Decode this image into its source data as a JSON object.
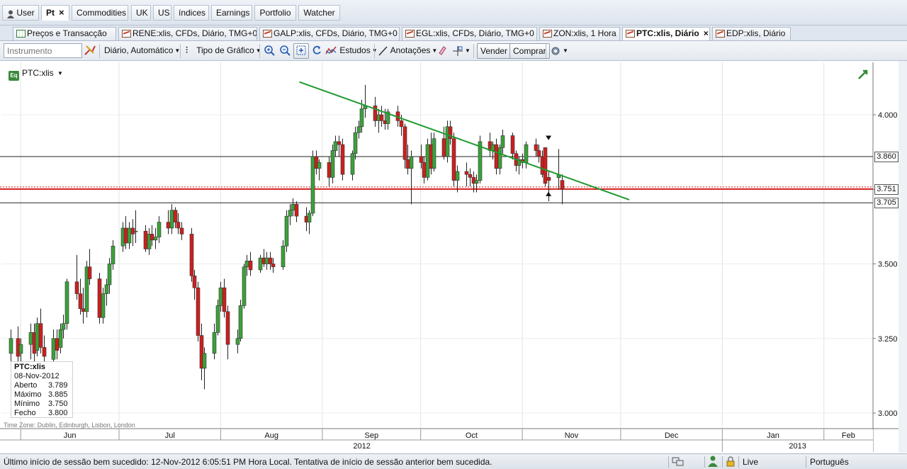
{
  "main_tabs": [
    {
      "label": "User",
      "icon": "user-icon"
    },
    {
      "label": "Pt",
      "active": true,
      "closable": true
    },
    {
      "label": "Commodities"
    },
    {
      "label": "UK"
    },
    {
      "label": "US"
    },
    {
      "label": "índices"
    },
    {
      "label": "Earnings"
    },
    {
      "label": "Portfolio"
    },
    {
      "label": "Watcher"
    }
  ],
  "chart_tabs": [
    {
      "label": "Preços e Transacção",
      "icon": "grid-icon"
    },
    {
      "label": "RENE:xlis, CFDs, Diário, TMG+0",
      "icon": "chart-icon"
    },
    {
      "label": "GALP:xlis, CFDs, Diário, TMG+0",
      "icon": "chart-icon"
    },
    {
      "label": "EGL:xlis, CFDs, Diário, TMG+0",
      "icon": "chart-icon"
    },
    {
      "label": "ZON:xlis, 1 Hora",
      "icon": "chart-icon"
    },
    {
      "label": "PTC:xlis, Diário",
      "icon": "chart-icon",
      "active": true,
      "closable": true
    },
    {
      "label": "EDP:xlis, Diário",
      "icon": "chart-icon"
    }
  ],
  "toolbar": {
    "instrument_placeholder": "Instrumento",
    "period": "Diário,  Automático",
    "chart_type": "Tipo de Gráfico",
    "studies": "Estudos",
    "annotations": "Anotações",
    "sell": "Vender",
    "buy": "Comprar"
  },
  "chart": {
    "symbol": "PTC:xlis",
    "time_zone": "Time Zone: Dublin, Edinburgh, Lisbon, London",
    "infobox": {
      "symbol": "PTC:xlis",
      "date": "08-Nov-2012",
      "rows": [
        {
          "label": "Aberto",
          "value": "3.789"
        },
        {
          "label": "Máximo",
          "value": "3.885"
        },
        {
          "label": "Mínimo",
          "value": "3.750"
        },
        {
          "label": "Fecho",
          "value": "3.800"
        }
      ]
    },
    "price_labels": {
      "resistance": "3.860",
      "current": "3.751",
      "support": "3.705"
    },
    "colors": {
      "up": "#3aa13a",
      "down": "#cc1f1f",
      "trendline": "#1f9a2f",
      "current_line": "#d81e1e"
    }
  },
  "chart_data": {
    "type": "candlestick",
    "ylim": [
      2.97,
      4.17
    ],
    "y_ticks": [
      "4.000",
      "3.750",
      "3.500",
      "3.250",
      "3.000"
    ],
    "months": [
      "Jun",
      "Jul",
      "Aug",
      "Sep",
      "Oct",
      "Nov",
      "Dec",
      "Jan",
      "Feb"
    ],
    "years": [
      "2012",
      "2013"
    ],
    "horizontal_lines": [
      3.86,
      3.751,
      3.705
    ],
    "trendline": {
      "from": {
        "date": "2012-08-25",
        "price": 4.11
      },
      "to": {
        "date": "2012-11-12",
        "price": 3.8
      }
    },
    "candles": [
      {
        "date": "2012-05-22",
        "o": 3.1,
        "h": 3.3,
        "l": 3.08,
        "c": 3.2
      },
      {
        "date": "2012-05-24",
        "o": 3.18,
        "h": 3.26,
        "l": 3.14,
        "c": 3.22
      },
      {
        "date": "2012-05-29",
        "o": 3.2,
        "h": 3.28,
        "l": 3.16,
        "c": 3.25
      },
      {
        "date": "2012-05-31",
        "o": 3.25,
        "h": 3.29,
        "l": 3.17,
        "c": 3.19
      },
      {
        "date": "2012-06-01",
        "o": 3.2,
        "h": 3.25,
        "l": 3.14,
        "c": 3.23
      },
      {
        "date": "2012-06-04",
        "o": 3.23,
        "h": 3.3,
        "l": 3.18,
        "c": 3.27
      },
      {
        "date": "2012-06-05",
        "o": 3.27,
        "h": 3.3,
        "l": 3.17,
        "c": 3.2
      },
      {
        "date": "2012-06-06",
        "o": 3.21,
        "h": 3.32,
        "l": 3.19,
        "c": 3.3
      },
      {
        "date": "2012-06-07",
        "o": 3.3,
        "h": 3.35,
        "l": 3.2,
        "c": 3.22
      },
      {
        "date": "2012-06-08",
        "o": 3.22,
        "h": 3.26,
        "l": 3.14,
        "c": 3.19
      },
      {
        "date": "2012-06-11",
        "o": 3.18,
        "h": 3.28,
        "l": 3.15,
        "c": 3.25
      },
      {
        "date": "2012-06-12",
        "o": 3.25,
        "h": 3.28,
        "l": 3.18,
        "c": 3.21
      },
      {
        "date": "2012-06-13",
        "o": 3.22,
        "h": 3.3,
        "l": 3.2,
        "c": 3.28
      },
      {
        "date": "2012-06-14",
        "o": 3.28,
        "h": 3.33,
        "l": 3.25,
        "c": 3.3
      },
      {
        "date": "2012-06-15",
        "o": 3.3,
        "h": 3.45,
        "l": 3.28,
        "c": 3.44
      },
      {
        "date": "2012-06-18",
        "o": 3.44,
        "h": 3.53,
        "l": 3.38,
        "c": 3.4
      },
      {
        "date": "2012-06-19",
        "o": 3.4,
        "h": 3.45,
        "l": 3.33,
        "c": 3.35
      },
      {
        "date": "2012-06-20",
        "o": 3.35,
        "h": 3.42,
        "l": 3.3,
        "c": 3.34
      },
      {
        "date": "2012-06-21",
        "o": 3.34,
        "h": 3.51,
        "l": 3.32,
        "c": 3.49
      },
      {
        "date": "2012-06-22",
        "o": 3.49,
        "h": 3.55,
        "l": 3.43,
        "c": 3.45
      },
      {
        "date": "2012-06-25",
        "o": 3.45,
        "h": 3.47,
        "l": 3.3,
        "c": 3.32
      },
      {
        "date": "2012-06-26",
        "o": 3.32,
        "h": 3.42,
        "l": 3.3,
        "c": 3.4
      },
      {
        "date": "2012-06-27",
        "o": 3.4,
        "h": 3.45,
        "l": 3.36,
        "c": 3.43
      },
      {
        "date": "2012-06-28",
        "o": 3.43,
        "h": 3.52,
        "l": 3.4,
        "c": 3.5
      },
      {
        "date": "2012-06-29",
        "o": 3.5,
        "h": 3.58,
        "l": 3.48,
        "c": 3.56
      },
      {
        "date": "2012-07-02",
        "o": 3.56,
        "h": 3.64,
        "l": 3.54,
        "c": 3.62
      },
      {
        "date": "2012-07-03",
        "o": 3.62,
        "h": 3.66,
        "l": 3.55,
        "c": 3.57
      },
      {
        "date": "2012-07-04",
        "o": 3.57,
        "h": 3.64,
        "l": 3.55,
        "c": 3.62
      },
      {
        "date": "2012-07-05",
        "o": 3.62,
        "h": 3.65,
        "l": 3.56,
        "c": 3.6
      },
      {
        "date": "2012-07-06",
        "o": 3.61,
        "h": 3.68,
        "l": 3.57,
        "c": 3.61
      },
      {
        "date": "2012-07-09",
        "o": 3.61,
        "h": 3.63,
        "l": 3.54,
        "c": 3.55
      },
      {
        "date": "2012-07-10",
        "o": 3.55,
        "h": 3.62,
        "l": 3.53,
        "c": 3.6
      },
      {
        "date": "2012-07-11",
        "o": 3.6,
        "h": 3.63,
        "l": 3.56,
        "c": 3.58
      },
      {
        "date": "2012-07-12",
        "o": 3.58,
        "h": 3.62,
        "l": 3.55,
        "c": 3.59
      },
      {
        "date": "2012-07-13",
        "o": 3.59,
        "h": 3.66,
        "l": 3.57,
        "c": 3.64
      },
      {
        "date": "2012-07-16",
        "o": 3.64,
        "h": 3.68,
        "l": 3.6,
        "c": 3.62
      },
      {
        "date": "2012-07-17",
        "o": 3.62,
        "h": 3.7,
        "l": 3.6,
        "c": 3.68
      },
      {
        "date": "2012-07-18",
        "o": 3.68,
        "h": 3.69,
        "l": 3.62,
        "c": 3.64
      },
      {
        "date": "2012-07-19",
        "o": 3.64,
        "h": 3.67,
        "l": 3.6,
        "c": 3.62
      },
      {
        "date": "2012-07-20",
        "o": 3.62,
        "h": 3.64,
        "l": 3.58,
        "c": 3.6
      },
      {
        "date": "2012-07-23",
        "o": 3.6,
        "h": 3.62,
        "l": 3.44,
        "c": 3.46
      },
      {
        "date": "2012-07-24",
        "o": 3.46,
        "h": 3.48,
        "l": 3.38,
        "c": 3.42
      },
      {
        "date": "2012-07-25",
        "o": 3.42,
        "h": 3.44,
        "l": 3.24,
        "c": 3.26
      },
      {
        "date": "2012-07-26",
        "o": 3.26,
        "h": 3.3,
        "l": 3.11,
        "c": 3.15
      },
      {
        "date": "2012-07-27",
        "o": 3.15,
        "h": 3.22,
        "l": 3.08,
        "c": 3.2
      },
      {
        "date": "2012-07-30",
        "o": 3.2,
        "h": 3.3,
        "l": 3.18,
        "c": 3.27
      },
      {
        "date": "2012-07-31",
        "o": 3.27,
        "h": 3.38,
        "l": 3.26,
        "c": 3.36
      },
      {
        "date": "2012-08-01",
        "o": 3.36,
        "h": 3.44,
        "l": 3.34,
        "c": 3.42
      },
      {
        "date": "2012-08-02",
        "o": 3.42,
        "h": 3.45,
        "l": 3.32,
        "c": 3.34
      },
      {
        "date": "2012-08-03",
        "o": 3.34,
        "h": 3.36,
        "l": 3.18,
        "c": 3.23
      },
      {
        "date": "2012-08-06",
        "o": 3.23,
        "h": 3.28,
        "l": 3.2,
        "c": 3.25
      },
      {
        "date": "2012-08-07",
        "o": 3.25,
        "h": 3.38,
        "l": 3.24,
        "c": 3.36
      },
      {
        "date": "2012-08-08",
        "o": 3.36,
        "h": 3.5,
        "l": 3.35,
        "c": 3.49
      },
      {
        "date": "2012-08-09",
        "o": 3.49,
        "h": 3.53,
        "l": 3.46,
        "c": 3.51
      },
      {
        "date": "2012-08-10",
        "o": 3.51,
        "h": 3.54,
        "l": 3.46,
        "c": 3.48
      },
      {
        "date": "2012-08-13",
        "o": 3.48,
        "h": 3.53,
        "l": 3.47,
        "c": 3.52
      },
      {
        "date": "2012-08-14",
        "o": 3.52,
        "h": 3.55,
        "l": 3.49,
        "c": 3.5
      },
      {
        "date": "2012-08-15",
        "o": 3.5,
        "h": 3.54,
        "l": 3.48,
        "c": 3.52
      },
      {
        "date": "2012-08-16",
        "o": 3.52,
        "h": 3.54,
        "l": 3.48,
        "c": 3.5
      },
      {
        "date": "2012-08-17",
        "o": 3.5,
        "h": 3.52,
        "l": 3.47,
        "c": 3.49
      },
      {
        "date": "2012-08-20",
        "o": 3.49,
        "h": 3.58,
        "l": 3.48,
        "c": 3.56
      },
      {
        "date": "2012-08-21",
        "o": 3.56,
        "h": 3.68,
        "l": 3.54,
        "c": 3.66
      },
      {
        "date": "2012-08-22",
        "o": 3.66,
        "h": 3.7,
        "l": 3.63,
        "c": 3.68
      },
      {
        "date": "2012-08-23",
        "o": 3.68,
        "h": 3.72,
        "l": 3.66,
        "c": 3.7
      },
      {
        "date": "2012-08-24",
        "o": 3.7,
        "h": 3.71,
        "l": 3.64,
        "c": 3.66
      },
      {
        "date": "2012-08-27",
        "o": 3.66,
        "h": 3.69,
        "l": 3.61,
        "c": 3.64
      },
      {
        "date": "2012-08-28",
        "o": 3.64,
        "h": 3.68,
        "l": 3.6,
        "c": 3.67
      },
      {
        "date": "2012-08-29",
        "o": 3.67,
        "h": 3.88,
        "l": 3.66,
        "c": 3.86
      },
      {
        "date": "2012-08-30",
        "o": 3.86,
        "h": 3.88,
        "l": 3.8,
        "c": 3.82
      },
      {
        "date": "2012-08-31",
        "o": 3.82,
        "h": 3.85,
        "l": 3.78,
        "c": 3.84
      },
      {
        "date": "2012-09-03",
        "o": 3.84,
        "h": 3.86,
        "l": 3.76,
        "c": 3.79
      },
      {
        "date": "2012-09-04",
        "o": 3.79,
        "h": 3.9,
        "l": 3.77,
        "c": 3.88
      },
      {
        "date": "2012-09-05",
        "o": 3.88,
        "h": 3.93,
        "l": 3.86,
        "c": 3.91
      },
      {
        "date": "2012-09-06",
        "o": 3.91,
        "h": 3.93,
        "l": 3.86,
        "c": 3.9
      },
      {
        "date": "2012-09-07",
        "o": 3.9,
        "h": 3.92,
        "l": 3.78,
        "c": 3.8
      },
      {
        "date": "2012-09-10",
        "o": 3.8,
        "h": 3.88,
        "l": 3.78,
        "c": 3.87
      },
      {
        "date": "2012-09-11",
        "o": 3.87,
        "h": 3.96,
        "l": 3.85,
        "c": 3.94
      },
      {
        "date": "2012-09-12",
        "o": 3.94,
        "h": 3.98,
        "l": 3.92,
        "c": 3.96
      },
      {
        "date": "2012-09-13",
        "o": 3.96,
        "h": 4.05,
        "l": 3.94,
        "c": 4.02
      },
      {
        "date": "2012-09-14",
        "o": 4.02,
        "h": 4.1,
        "l": 3.99,
        "c": 4.03
      },
      {
        "date": "2012-09-17",
        "o": 4.03,
        "h": 4.06,
        "l": 3.96,
        "c": 3.98
      },
      {
        "date": "2012-09-18",
        "o": 3.98,
        "h": 4.02,
        "l": 3.94,
        "c": 4.0
      },
      {
        "date": "2012-09-19",
        "o": 4.0,
        "h": 4.03,
        "l": 3.96,
        "c": 3.98
      },
      {
        "date": "2012-09-20",
        "o": 3.98,
        "h": 4.02,
        "l": 3.95,
        "c": 3.97
      },
      {
        "date": "2012-09-21",
        "o": 3.97,
        "h": 4.02,
        "l": 3.95,
        "c": 4.01
      },
      {
        "date": "2012-09-24",
        "o": 4.01,
        "h": 4.03,
        "l": 3.96,
        "c": 3.98
      },
      {
        "date": "2012-09-25",
        "o": 3.98,
        "h": 4.0,
        "l": 3.93,
        "c": 3.96
      },
      {
        "date": "2012-09-26",
        "o": 3.96,
        "h": 3.97,
        "l": 3.82,
        "c": 3.85
      },
      {
        "date": "2012-09-27",
        "o": 3.85,
        "h": 3.9,
        "l": 3.8,
        "c": 3.82
      },
      {
        "date": "2012-09-28",
        "o": 3.82,
        "h": 3.88,
        "l": 3.7,
        "c": 3.86
      },
      {
        "date": "2012-10-01",
        "o": 3.86,
        "h": 3.9,
        "l": 3.82,
        "c": 3.84
      },
      {
        "date": "2012-10-02",
        "o": 3.84,
        "h": 3.86,
        "l": 3.77,
        "c": 3.79
      },
      {
        "date": "2012-10-03",
        "o": 3.79,
        "h": 3.92,
        "l": 3.78,
        "c": 3.9
      },
      {
        "date": "2012-10-04",
        "o": 3.9,
        "h": 3.94,
        "l": 3.8,
        "c": 3.82
      },
      {
        "date": "2012-10-05",
        "o": 3.82,
        "h": 3.94,
        "l": 3.81,
        "c": 3.92
      },
      {
        "date": "2012-10-08",
        "o": 3.92,
        "h": 3.96,
        "l": 3.85,
        "c": 3.86
      },
      {
        "date": "2012-10-09",
        "o": 3.86,
        "h": 3.98,
        "l": 3.84,
        "c": 3.96
      },
      {
        "date": "2012-10-10",
        "o": 3.96,
        "h": 3.98,
        "l": 3.9,
        "c": 3.92
      },
      {
        "date": "2012-10-11",
        "o": 3.92,
        "h": 3.94,
        "l": 3.76,
        "c": 3.78
      },
      {
        "date": "2012-10-12",
        "o": 3.78,
        "h": 3.83,
        "l": 3.74,
        "c": 3.81
      },
      {
        "date": "2012-10-15",
        "o": 3.81,
        "h": 3.84,
        "l": 3.76,
        "c": 3.8
      },
      {
        "date": "2012-10-16",
        "o": 3.8,
        "h": 3.82,
        "l": 3.76,
        "c": 3.79
      },
      {
        "date": "2012-10-17",
        "o": 3.79,
        "h": 3.81,
        "l": 3.74,
        "c": 3.77
      },
      {
        "date": "2012-10-18",
        "o": 3.77,
        "h": 3.8,
        "l": 3.74,
        "c": 3.78
      },
      {
        "date": "2012-10-19",
        "o": 3.78,
        "h": 3.93,
        "l": 3.77,
        "c": 3.91
      },
      {
        "date": "2012-10-22",
        "o": 3.91,
        "h": 3.94,
        "l": 3.86,
        "c": 3.88
      },
      {
        "date": "2012-10-23",
        "o": 3.88,
        "h": 3.91,
        "l": 3.85,
        "c": 3.9
      },
      {
        "date": "2012-10-24",
        "o": 3.9,
        "h": 3.92,
        "l": 3.8,
        "c": 3.82
      },
      {
        "date": "2012-10-25",
        "o": 3.82,
        "h": 3.9,
        "l": 3.8,
        "c": 3.89
      },
      {
        "date": "2012-10-26",
        "o": 3.89,
        "h": 3.95,
        "l": 3.87,
        "c": 3.93
      },
      {
        "date": "2012-10-29",
        "o": 3.93,
        "h": 3.94,
        "l": 3.85,
        "c": 3.87
      },
      {
        "date": "2012-10-30",
        "o": 3.87,
        "h": 3.88,
        "l": 3.81,
        "c": 3.83
      },
      {
        "date": "2012-10-31",
        "o": 3.83,
        "h": 3.86,
        "l": 3.8,
        "c": 3.85
      },
      {
        "date": "2012-11-01",
        "o": 3.85,
        "h": 3.87,
        "l": 3.82,
        "c": 3.84
      },
      {
        "date": "2012-11-02",
        "o": 3.84,
        "h": 3.91,
        "l": 3.82,
        "c": 3.9
      },
      {
        "date": "2012-11-05",
        "o": 3.9,
        "h": 3.92,
        "l": 3.86,
        "c": 3.88
      },
      {
        "date": "2012-11-06",
        "o": 3.88,
        "h": 3.9,
        "l": 3.84,
        "c": 3.86
      },
      {
        "date": "2012-11-07",
        "o": 3.86,
        "h": 3.88,
        "l": 3.79,
        "c": 3.8
      },
      {
        "date": "2012-11-08",
        "o": 3.89,
        "h": 3.89,
        "l": 3.76,
        "c": 3.77
      },
      {
        "date": "2012-11-09",
        "o": 3.79,
        "h": 3.81,
        "l": 3.71,
        "c": 3.78
      },
      {
        "date": "2012-11-12",
        "o": 3.789,
        "h": 3.885,
        "l": 3.75,
        "c": 3.8
      },
      {
        "date": "2012-11-13",
        "o": 3.78,
        "h": 3.8,
        "l": 3.7,
        "c": 3.751
      }
    ]
  },
  "status_bar": {
    "message": "Último início de sessão bem sucedido: 12-Nov-2012 6:05:51 PM Hora Local. Tentativa de início de sessão anterior bem sucedida.",
    "connection": "Live",
    "language": "Português"
  }
}
